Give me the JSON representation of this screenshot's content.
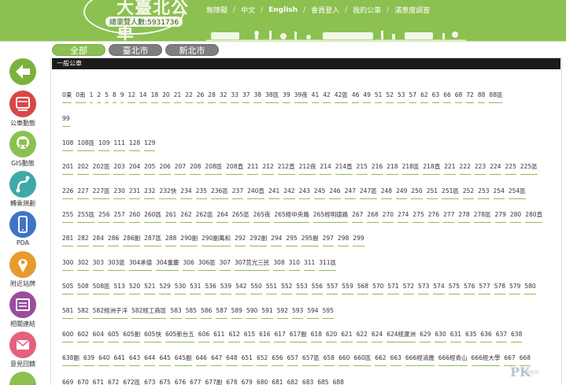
{
  "colors": {
    "brand_green": "#8cc051",
    "tab_gray": "#7e7e7e",
    "section_bar": "#1b1b1b",
    "accent_orange": "#e79b2e",
    "accent_red": "#d8474a",
    "accent_teal": "#3fa9a9",
    "accent_blue": "#3e74c8",
    "accent_purple": "#9b4d9c",
    "accent_pink": "#e4607c"
  },
  "header": {
    "logo_text": "大臺北公車",
    "visitors": "總瀏覽人數:5931736",
    "nav": [
      "無障礙",
      "中文",
      "English",
      "會員登入",
      "我的公車",
      "滿意度調查"
    ],
    "nav_separator": "/"
  },
  "tabs": [
    "全部",
    "臺北市",
    "新北市"
  ],
  "sidebar": [
    {
      "icon": "back-arrow-icon",
      "label": "",
      "color": "#7bb13c"
    },
    {
      "icon": "bus-dynamic-icon",
      "label": "公車動態",
      "color": "#d8474a"
    },
    {
      "icon": "gis-map-icon",
      "label": "GIS動態",
      "color": "#8cc051"
    },
    {
      "icon": "transfer-route-icon",
      "label": "轉乘規劃",
      "color": "#3fa9a9"
    },
    {
      "icon": "pda-phone-icon",
      "label": "PDA",
      "color": "#3e74c8"
    },
    {
      "icon": "nearby-stop-icon",
      "label": "附近站牌",
      "color": "#e79b2e"
    },
    {
      "icon": "related-links-icon",
      "label": "相關連結",
      "color": "#9b4d9c"
    },
    {
      "icon": "feedback-mail-icon",
      "label": "意見回饋",
      "color": "#e4607c"
    }
  ],
  "section_title": "一般公車",
  "route_rows": [
    [
      "0東",
      "0南",
      "1",
      "2",
      "5",
      "8",
      "9",
      "12",
      "14",
      "18",
      "20",
      "21",
      "22",
      "26",
      "28",
      "32",
      "33",
      "37",
      "38",
      "38區",
      "39",
      "39夜",
      "41",
      "42",
      "42區",
      "46",
      "49",
      "51",
      "52",
      "53",
      "57",
      "62",
      "63",
      "66",
      "68",
      "72",
      "88",
      "88區"
    ],
    [
      "99"
    ],
    [
      "108",
      "108區",
      "109",
      "111",
      "128",
      "129"
    ],
    [
      "201",
      "202",
      "202區",
      "203",
      "204",
      "205",
      "206",
      "207",
      "208",
      "208區",
      "208直",
      "211",
      "212",
      "212直",
      "212夜",
      "214",
      "214直",
      "215",
      "216",
      "218",
      "218區",
      "218直",
      "221",
      "222",
      "223",
      "224",
      "225",
      "225區"
    ],
    [
      "226",
      "227",
      "227區",
      "230",
      "231",
      "232",
      "232快",
      "234",
      "235",
      "236區",
      "237",
      "240直",
      "241",
      "242",
      "243",
      "245",
      "246",
      "247",
      "247區",
      "248",
      "249",
      "250",
      "251",
      "251區",
      "252",
      "253",
      "254",
      "254區"
    ],
    [
      "255",
      "255區",
      "256",
      "257",
      "260",
      "260區",
      "261",
      "262",
      "262區",
      "264",
      "265區",
      "265夜",
      "265經中央路",
      "265經明德路",
      "267",
      "268",
      "270",
      "274",
      "275",
      "276",
      "277",
      "278",
      "278區",
      "279",
      "280",
      "280直"
    ],
    [
      "281",
      "282",
      "284",
      "286",
      "286副",
      "287區",
      "288",
      "290副",
      "290副萬和",
      "292",
      "292副",
      "294",
      "295",
      "295副",
      "297",
      "298",
      "299"
    ],
    [
      "300",
      "302",
      "303",
      "303區",
      "304承德",
      "304重慶",
      "306",
      "306區",
      "307",
      "307莒光三民",
      "308",
      "310",
      "311",
      "311區"
    ],
    [
      "505",
      "508",
      "508區",
      "513",
      "520",
      "521",
      "529",
      "530",
      "531",
      "536",
      "539",
      "542",
      "550",
      "551",
      "552",
      "553",
      "556",
      "557",
      "559",
      "568",
      "570",
      "571",
      "572",
      "573",
      "574",
      "575",
      "576",
      "577",
      "578",
      "579",
      "580"
    ],
    [
      "581",
      "582",
      "582經洲子洋",
      "582經工商區",
      "583",
      "585",
      "586",
      "587",
      "589",
      "590",
      "591",
      "592",
      "593",
      "594",
      "595"
    ],
    [
      "600",
      "602",
      "604",
      "605",
      "605副",
      "605快",
      "605新台五",
      "606",
      "611",
      "612",
      "615",
      "616",
      "617",
      "617副",
      "618",
      "620",
      "621",
      "622",
      "624",
      "624經蘆洲",
      "629",
      "630",
      "631",
      "635",
      "636",
      "637",
      "638"
    ],
    [
      "638副",
      "639",
      "640",
      "641",
      "643",
      "644",
      "645",
      "645副",
      "646",
      "647",
      "648",
      "651",
      "652",
      "656",
      "657",
      "657區",
      "658",
      "660",
      "660區",
      "662",
      "663",
      "666經湳雅",
      "666經青山",
      "666經大學",
      "667",
      "668"
    ],
    [
      "669",
      "670",
      "671",
      "672",
      "672區",
      "673",
      "675",
      "676",
      "677",
      "677副",
      "678",
      "679",
      "680",
      "681",
      "682",
      "683",
      "685",
      "688"
    ]
  ],
  "watermark": {
    "text": "PK",
    "sub": "痞客邦"
  }
}
